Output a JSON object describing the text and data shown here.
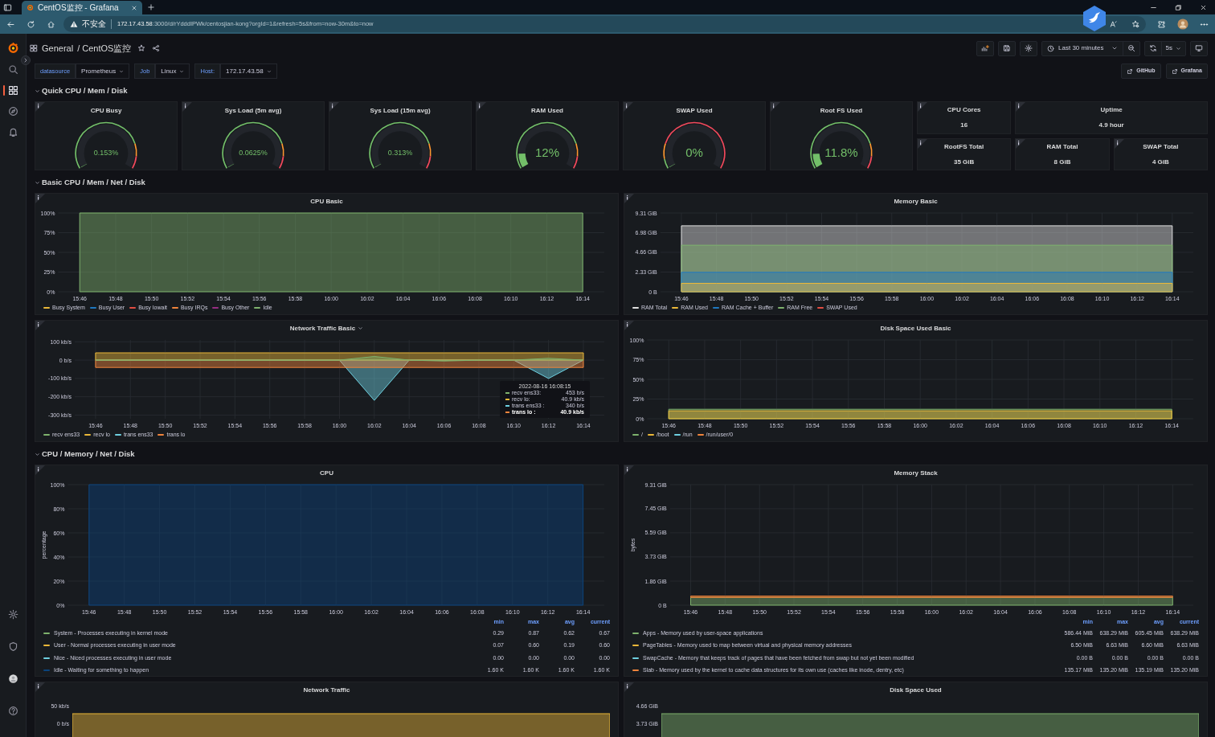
{
  "browser": {
    "tab_title": "CentOS监控 - Grafana",
    "security_label": "不安全",
    "url_host": "172.17.43.58",
    "url_rest": ":3000/d/rYdddIPWk/centosjian-kong?orgId=1&refresh=5s&from=now-30m&to=now"
  },
  "sidebar": {
    "items": [
      {
        "kind": "search",
        "selected": false
      },
      {
        "kind": "dashboards",
        "selected": true
      },
      {
        "kind": "explore",
        "selected": false
      },
      {
        "kind": "alerting",
        "selected": false
      }
    ],
    "bottom_items": [
      {
        "kind": "settings"
      },
      {
        "kind": "shield"
      },
      {
        "kind": "avatar"
      },
      {
        "kind": "help"
      }
    ]
  },
  "header": {
    "folder": "General",
    "separator": "/",
    "title": "CentOS监控",
    "time_range": "Last 30 minutes",
    "refresh_interval": "5s"
  },
  "variables": [
    {
      "label": "datasource",
      "value": "Prometheus"
    },
    {
      "label": "Job",
      "value": "Linux"
    },
    {
      "label": "Host:",
      "value": "172.17.43.58"
    }
  ],
  "links": [
    "GitHub",
    "Grafana"
  ],
  "rows": [
    {
      "title": "Quick CPU / Mem / Disk",
      "expanded": true,
      "kind": "gauges",
      "gauges": [
        {
          "title": "CPU Busy",
          "value": "0.153%",
          "level": 0.00153,
          "inverted_thresholds": false
        },
        {
          "title": "Sys Load (5m avg)",
          "value": "0.0625%",
          "level": 0.000625,
          "inverted_thresholds": false
        },
        {
          "title": "Sys Load (15m avg)",
          "value": "0.313%",
          "level": 0.00313,
          "inverted_thresholds": false
        },
        {
          "title": "RAM Used",
          "value": "12%",
          "level": 0.12,
          "inverted_thresholds": false
        },
        {
          "title": "SWAP Used",
          "value": "0%",
          "level": 0,
          "inverted_thresholds": true
        },
        {
          "title": "Root FS Used",
          "value": "11.8%",
          "level": 0.118,
          "inverted_thresholds": false
        }
      ],
      "stats": [
        {
          "title": "CPU Cores",
          "value": "16"
        },
        {
          "title": "Uptime",
          "value": "4.9 hour"
        },
        {
          "title": "RootFS Total",
          "value": "35 GiB"
        },
        {
          "title": "RAM Total",
          "value": "8 GiB"
        },
        {
          "title": "SWAP Total",
          "value": "4 GiB"
        }
      ]
    },
    {
      "title": "Basic CPU / Mem / Net / Disk",
      "expanded": true,
      "kind": "basic",
      "panels": [
        {
          "title": "CPU Basic",
          "chart_data": {
            "type": "area",
            "stacked": true,
            "grid": true,
            "categories": [
              "15:46",
              "15:48",
              "15:50",
              "15:52",
              "15:54",
              "15:56",
              "15:58",
              "16:00",
              "16:02",
              "16:04",
              "16:06",
              "16:08",
              "16:10",
              "16:12",
              "16:14"
            ],
            "ylim": [
              0,
              100
            ],
            "yticks": [
              {
                "value": 0,
                "label": "0%"
              },
              {
                "value": 25,
                "label": "25%"
              },
              {
                "value": 50,
                "label": "50%"
              },
              {
                "value": 75,
                "label": "75%"
              },
              {
                "value": 100,
                "label": "100%"
              }
            ],
            "series": [
              {
                "name": "Busy System",
                "color": "#eab839",
                "values": [
                  null,
                  null,
                  null,
                  null,
                  null,
                  null,
                  null,
                  null,
                  null,
                  null,
                  null,
                  null,
                  null,
                  null,
                  null
                ]
              },
              {
                "name": "Busy User",
                "color": "#1f78c1",
                "values": [
                  null,
                  null,
                  null,
                  null,
                  null,
                  null,
                  null,
                  null,
                  null,
                  null,
                  null,
                  null,
                  null,
                  null,
                  null
                ]
              },
              {
                "name": "Busy Iowait",
                "color": "#e24d42",
                "values": [
                  null,
                  null,
                  null,
                  null,
                  null,
                  null,
                  null,
                  null,
                  null,
                  null,
                  null,
                  null,
                  null,
                  null,
                  null
                ]
              },
              {
                "name": "Busy IRQs",
                "color": "#ef843c",
                "values": [
                  null,
                  null,
                  null,
                  null,
                  null,
                  null,
                  null,
                  null,
                  null,
                  null,
                  null,
                  null,
                  null,
                  null,
                  null
                ]
              },
              {
                "name": "Busy Other",
                "color": "#962d82",
                "values": [
                  null,
                  null,
                  null,
                  null,
                  null,
                  null,
                  null,
                  null,
                  null,
                  null,
                  null,
                  null,
                  null,
                  null,
                  null
                ]
              },
              {
                "name": "Idle",
                "color": "#7eb26d",
                "values": [
                  100,
                  100,
                  100,
                  100,
                  100,
                  100,
                  100,
                  100,
                  100,
                  100,
                  100,
                  100,
                  100,
                  100,
                  100
                ]
              }
            ]
          }
        },
        {
          "title": "Memory Basic",
          "chart_data": {
            "type": "area",
            "stacked": false,
            "grid": true,
            "categories": [
              "15:46",
              "15:48",
              "15:50",
              "15:52",
              "15:54",
              "15:56",
              "15:58",
              "16:00",
              "16:02",
              "16:04",
              "16:06",
              "16:08",
              "16:10",
              "16:12",
              "16:14"
            ],
            "ylim": [
              0,
              9.31
            ],
            "yticks": [
              {
                "value": 0,
                "label": "0 B"
              },
              {
                "value": 2.33,
                "label": "2.33 GiB"
              },
              {
                "value": 4.66,
                "label": "4.66 GiB"
              },
              {
                "value": 6.98,
                "label": "6.98 GiB"
              },
              {
                "value": 9.31,
                "label": "9.31 GiB"
              }
            ],
            "series": [
              {
                "name": "RAM Total",
                "color": "#e0e0e0",
                "values": [
                  7.8,
                  7.8,
                  7.8,
                  7.8,
                  7.8,
                  7.8,
                  7.8,
                  7.8,
                  7.8,
                  7.8,
                  7.8,
                  7.8,
                  7.8,
                  7.8,
                  7.8
                ]
              },
              {
                "name": "RAM Used",
                "color": "#eab839",
                "values": [
                  1,
                  1,
                  1,
                  1,
                  1,
                  1,
                  1,
                  1,
                  1,
                  1,
                  1,
                  1,
                  1,
                  1,
                  1
                ]
              },
              {
                "name": "RAM Cache + Buffer",
                "color": "#1f78c1",
                "values": [
                  2.3,
                  2.3,
                  2.3,
                  2.3,
                  2.3,
                  2.3,
                  2.3,
                  2.3,
                  2.3,
                  2.3,
                  2.3,
                  2.3,
                  2.3,
                  2.3,
                  2.3
                ]
              },
              {
                "name": "RAM Free",
                "color": "#7eb26d",
                "values": [
                  5.5,
                  5.5,
                  5.5,
                  5.5,
                  5.5,
                  5.5,
                  5.5,
                  5.5,
                  5.5,
                  5.5,
                  5.5,
                  5.5,
                  5.5,
                  5.5,
                  5.5
                ]
              },
              {
                "name": "SWAP Used",
                "color": "#e24d42",
                "values": [
                  null,
                  null,
                  null,
                  null,
                  null,
                  null,
                  null,
                  null,
                  null,
                  null,
                  null,
                  null,
                  null,
                  null,
                  null
                ]
              }
            ]
          }
        },
        {
          "title": "Network Traffic Basic",
          "title_menu": true,
          "tooltip": {
            "time": "2022-08-16 16:08:15",
            "rows": [
              {
                "label": "recv ens33:",
                "value": "453 b/s",
                "highlighted": false
              },
              {
                "label": "recv lo:",
                "value": "40.9 kb/s",
                "highlighted": false
              },
              {
                "label": "trans ens33 :",
                "value": "340 b/s",
                "highlighted": false
              },
              {
                "label": "trans lo :",
                "value": "40.9 kb/s",
                "highlighted": true
              }
            ]
          },
          "chart_data": {
            "type": "area",
            "stacked": false,
            "grid": true,
            "categories": [
              "15:46",
              "15:48",
              "15:50",
              "15:52",
              "15:54",
              "15:56",
              "15:58",
              "16:00",
              "16:02",
              "16:04",
              "16:06",
              "16:08",
              "16:10",
              "16:12",
              "16:14"
            ],
            "ylim": [
              -320,
              110
            ],
            "yticks": [
              {
                "value": 100,
                "label": "100 kb/s"
              },
              {
                "value": 0,
                "label": "0 b/s"
              },
              {
                "value": -100,
                "label": "-100 kb/s"
              },
              {
                "value": -200,
                "label": "-200 kb/s"
              },
              {
                "value": -300,
                "label": "-300 kb/s"
              }
            ],
            "series": [
              {
                "name": "recv ens33",
                "color": "#7eb26d",
                "values": [
                  0,
                  0,
                  0,
                  0,
                  0,
                  0,
                  0,
                  0,
                  20,
                  0,
                  -5,
                  0,
                  0,
                  10,
                  0
                ]
              },
              {
                "name": "recv lo",
                "color": "#eab839",
                "values": [
                  40,
                  40,
                  40,
                  40,
                  40,
                  40,
                  40,
                  40,
                  40,
                  40,
                  40,
                  40,
                  40,
                  40,
                  40
                ]
              },
              {
                "name": "trans ens33",
                "color": "#6ed0e0",
                "values": [
                  0,
                  0,
                  0,
                  0,
                  0,
                  0,
                  0,
                  0,
                  -220,
                  0,
                  0,
                  0,
                  0,
                  -100,
                  0
                ]
              },
              {
                "name": "trans lo",
                "color": "#ef843c",
                "values": [
                  -40,
                  -40,
                  -40,
                  -40,
                  -40,
                  -40,
                  -40,
                  -40,
                  -40,
                  -40,
                  -40,
                  -40,
                  -40,
                  -40,
                  -40
                ]
              }
            ]
          }
        },
        {
          "title": "Disk Space Used Basic",
          "chart_data": {
            "type": "area",
            "stacked": false,
            "grid": true,
            "categories": [
              "15:46",
              "15:48",
              "15:50",
              "15:52",
              "15:54",
              "15:56",
              "15:58",
              "16:00",
              "16:02",
              "16:04",
              "16:06",
              "16:08",
              "16:10",
              "16:12",
              "16:14"
            ],
            "ylim": [
              0,
              100
            ],
            "yticks": [
              {
                "value": 0,
                "label": "0%"
              },
              {
                "value": 25,
                "label": "25%"
              },
              {
                "value": 50,
                "label": "50%"
              },
              {
                "value": 75,
                "label": "75%"
              },
              {
                "value": 100,
                "label": "100%"
              }
            ],
            "series": [
              {
                "name": "/",
                "color": "#7eb26d",
                "values": [
                  12,
                  12,
                  12,
                  12,
                  12,
                  12,
                  12,
                  12,
                  12,
                  12,
                  12,
                  12,
                  12,
                  12,
                  12
                ]
              },
              {
                "name": "/boot",
                "color": "#eab839",
                "values": [
                  10,
                  10,
                  10,
                  10,
                  10,
                  10,
                  10,
                  10,
                  10,
                  10,
                  10,
                  10,
                  10,
                  10,
                  10
                ]
              },
              {
                "name": "/run",
                "color": "#6ed0e0",
                "values": [
                  null,
                  null,
                  null,
                  null,
                  null,
                  null,
                  null,
                  null,
                  null,
                  null,
                  null,
                  null,
                  null,
                  null,
                  null
                ]
              },
              {
                "name": "/run/user/0",
                "color": "#ef843c",
                "values": [
                  null,
                  null,
                  null,
                  null,
                  null,
                  null,
                  null,
                  null,
                  null,
                  null,
                  null,
                  null,
                  null,
                  null,
                  null
                ]
              }
            ]
          }
        }
      ]
    },
    {
      "title": "CPU / Memory / Net / Disk",
      "expanded": true,
      "kind": "detail",
      "panels": [
        {
          "title": "CPU",
          "legend_columns": [
            "min",
            "max",
            "avg",
            "current"
          ],
          "legend_rows": [
            [
              "0.29",
              "0.87",
              "0.62",
              "0.67"
            ],
            [
              "0.07",
              "0.60",
              "0.19",
              "0.60"
            ],
            [
              "0.00",
              "0.00",
              "0.00",
              "0.00"
            ],
            [
              "1.60 K",
              "1.60 K",
              "1.60 K",
              "1.60 K"
            ]
          ],
          "chart_data": {
            "type": "area",
            "stacked": true,
            "grid": true,
            "ylabel": "percentage",
            "categories": [
              "15:46",
              "15:48",
              "15:50",
              "15:52",
              "15:54",
              "15:56",
              "15:58",
              "16:00",
              "16:02",
              "16:04",
              "16:06",
              "16:08",
              "16:10",
              "16:12",
              "16:14"
            ],
            "ylim": [
              0,
              100
            ],
            "yticks": [
              {
                "value": 0,
                "label": "0%"
              },
              {
                "value": 20,
                "label": "20%"
              },
              {
                "value": 40,
                "label": "40%"
              },
              {
                "value": 60,
                "label": "60%"
              },
              {
                "value": 80,
                "label": "80%"
              },
              {
                "value": 100,
                "label": "100%"
              }
            ],
            "series": [
              {
                "name": "System - Processes executing in kernel mode",
                "color": "#7eb26d",
                "values": [
                  null,
                  null,
                  null,
                  null,
                  null,
                  null,
                  null,
                  null,
                  null,
                  null,
                  null,
                  null,
                  null,
                  null,
                  null
                ]
              },
              {
                "name": "User - Normal processes executing in user mode",
                "color": "#eab839",
                "values": [
                  null,
                  null,
                  null,
                  null,
                  null,
                  null,
                  null,
                  null,
                  null,
                  null,
                  null,
                  null,
                  null,
                  null,
                  null
                ]
              },
              {
                "name": "Nice - Niced processes executing in user mode",
                "color": "#6ed0e0",
                "values": [
                  null,
                  null,
                  null,
                  null,
                  null,
                  null,
                  null,
                  null,
                  null,
                  null,
                  null,
                  null,
                  null,
                  null,
                  null
                ]
              },
              {
                "name": "Idle - Waiting for something to happen",
                "color": "#0a437c",
                "values": [
                  100,
                  100,
                  100,
                  100,
                  100,
                  100,
                  100,
                  100,
                  100,
                  100,
                  100,
                  100,
                  100,
                  100,
                  100
                ]
              }
            ]
          }
        },
        {
          "title": "Memory Stack",
          "legend_columns": [
            "min",
            "max",
            "avg",
            "current"
          ],
          "legend_rows": [
            [
              "586.44 MiB",
              "638.29 MiB",
              "605.45 MiB",
              "638.29 MiB"
            ],
            [
              "6.50 MiB",
              "6.63 MiB",
              "6.60 MiB",
              "6.63 MiB"
            ],
            [
              "0.00 B",
              "0.00 B",
              "0.00 B",
              "0.00 B"
            ],
            [
              "135.17 MiB",
              "135.20 MiB",
              "135.19 MiB",
              "135.20 MiB"
            ]
          ],
          "chart_data": {
            "type": "area",
            "stacked": true,
            "grid": true,
            "ylabel": "bytes",
            "categories": [
              "15:46",
              "15:48",
              "15:50",
              "15:52",
              "15:54",
              "15:56",
              "15:58",
              "16:00",
              "16:02",
              "16:04",
              "16:06",
              "16:08",
              "16:10",
              "16:12",
              "16:14"
            ],
            "ylim": [
              0,
              9.31
            ],
            "yticks": [
              {
                "value": 0,
                "label": "0 B"
              },
              {
                "value": 1.86,
                "label": "1.86 GiB"
              },
              {
                "value": 3.73,
                "label": "3.73 GiB"
              },
              {
                "value": 5.59,
                "label": "5.59 GiB"
              },
              {
                "value": 7.45,
                "label": "7.45 GiB"
              },
              {
                "value": 9.31,
                "label": "9.31 GiB"
              }
            ],
            "series": [
              {
                "name": "Apps - Memory used by user-space applications",
                "color": "#7eb26d",
                "values": [
                  0.6,
                  0.6,
                  0.6,
                  0.6,
                  0.6,
                  0.6,
                  0.6,
                  0.6,
                  0.6,
                  0.6,
                  0.6,
                  0.6,
                  0.6,
                  0.6,
                  0.6
                ]
              },
              {
                "name": "PageTables - Memory used to map between virtual and physical memory addresses",
                "color": "#eab839",
                "values": [
                  null,
                  null,
                  null,
                  null,
                  null,
                  null,
                  null,
                  null,
                  null,
                  null,
                  null,
                  null,
                  null,
                  null,
                  null
                ]
              },
              {
                "name": "SwapCache - Memory that keeps track of pages that have been fetched from swap but not yet been modified",
                "color": "#6ed0e0",
                "values": [
                  null,
                  null,
                  null,
                  null,
                  null,
                  null,
                  null,
                  null,
                  null,
                  null,
                  null,
                  null,
                  null,
                  null,
                  null
                ]
              },
              {
                "name": "Slab - Memory used by the kernel to cache data structures for its own use (caches like inode, dentry, etc)",
                "color": "#ef843c",
                "values": [
                  0.1,
                  0.1,
                  0.1,
                  0.1,
                  0.1,
                  0.1,
                  0.1,
                  0.1,
                  0.1,
                  0.1,
                  0.1,
                  0.1,
                  0.1,
                  0.1,
                  0.1
                ]
              }
            ]
          }
        },
        {
          "title": "Network Traffic",
          "y_labels": [
            "50 kb/s",
            "0 b/s"
          ]
        },
        {
          "title": "Disk Space Used",
          "y_labels": [
            "4.66 GiB",
            "3.73 GiB"
          ]
        }
      ]
    }
  ]
}
